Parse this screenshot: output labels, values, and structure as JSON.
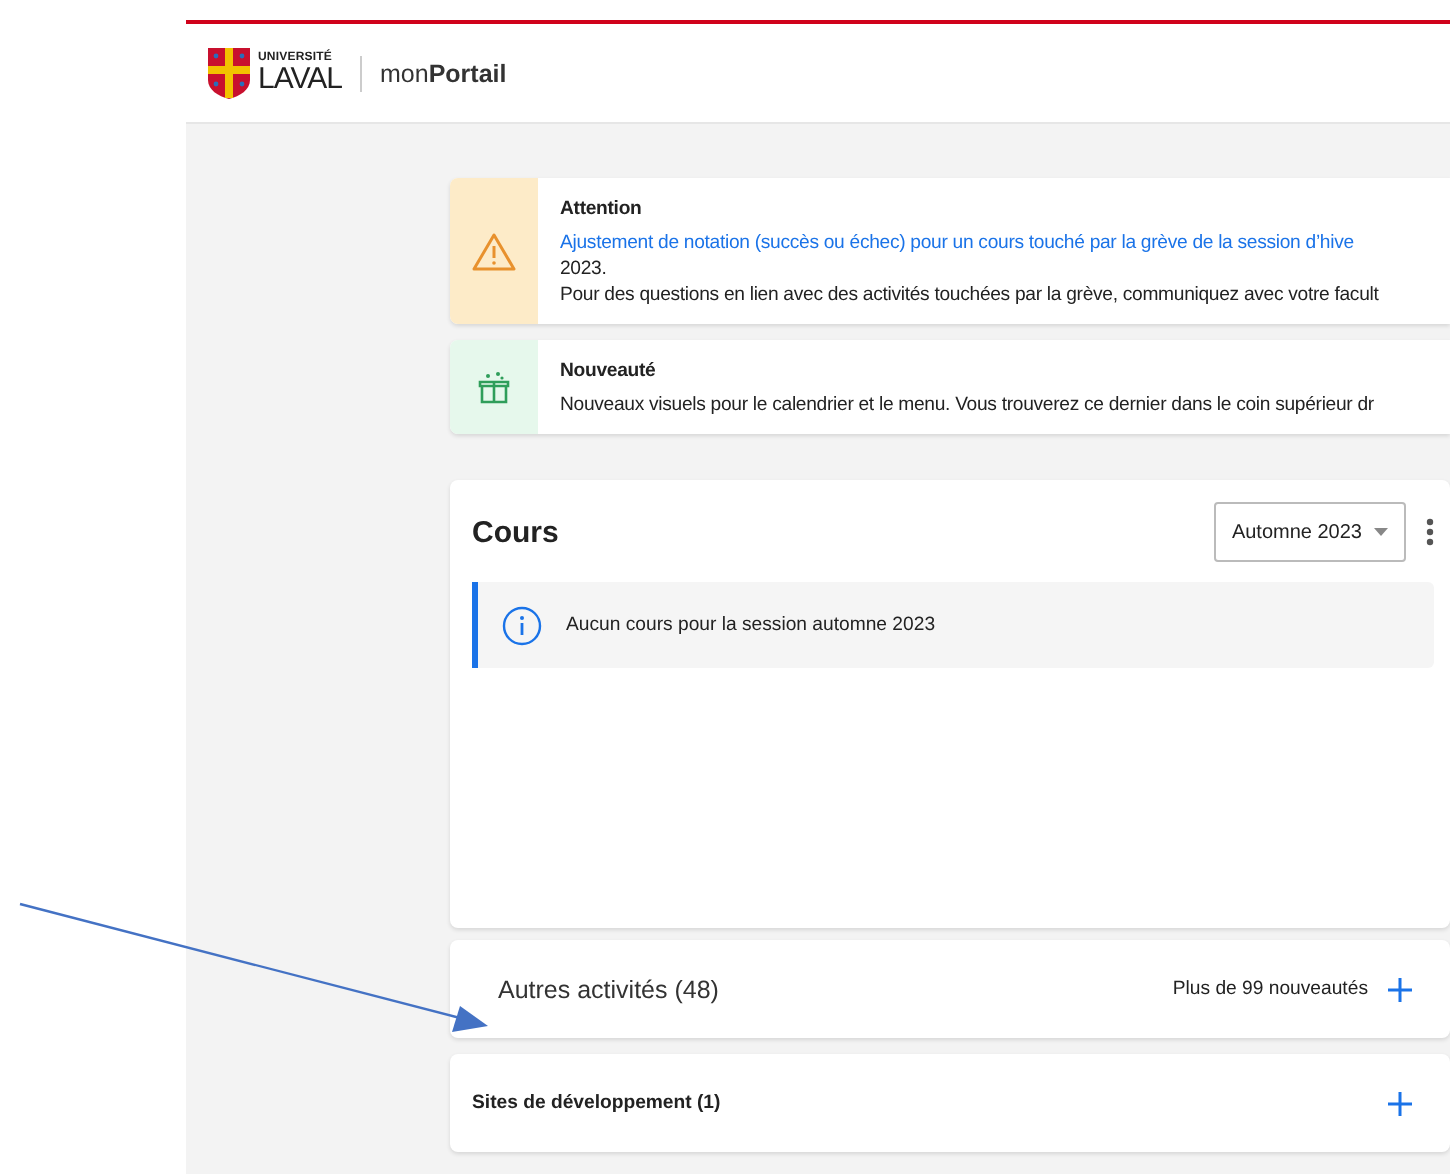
{
  "header": {
    "logo_top": "UNIVERSITÉ",
    "logo_bottom": "LAVAL",
    "app_name": "mon**Portail**"
  },
  "notices": [
    {
      "kind": "warning",
      "title": "Attention",
      "lines": [
        {
          "kind": "link",
          "text": "Ajustement de notation (succès ou échec) pour un cours touché par la grève de la session d’hive"
        },
        {
          "kind": "text",
          "text": "2023."
        },
        {
          "kind": "text",
          "text": "Pour des questions en lien avec des activités touchées par la grève, communiquez avec votre facult"
        }
      ]
    },
    {
      "kind": "new",
      "title": "Nouveauté",
      "lines": [
        {
          "kind": "text",
          "text": "Nouveaux visuels pour le calendrier et le menu. Vous trouverez ce dernier dans le coin supérieur dr"
        }
      ]
    }
  ],
  "courses": {
    "title": "Cours",
    "session": "Automne 2023",
    "info": "Aucun cours pour la session automne 2023"
  },
  "sections": [
    {
      "kind": "large",
      "title": "Autres activités (48)",
      "badge": "Plus de 99 nouveautés"
    },
    {
      "kind": "bold",
      "title": "Sites de développement (1)"
    }
  ]
}
